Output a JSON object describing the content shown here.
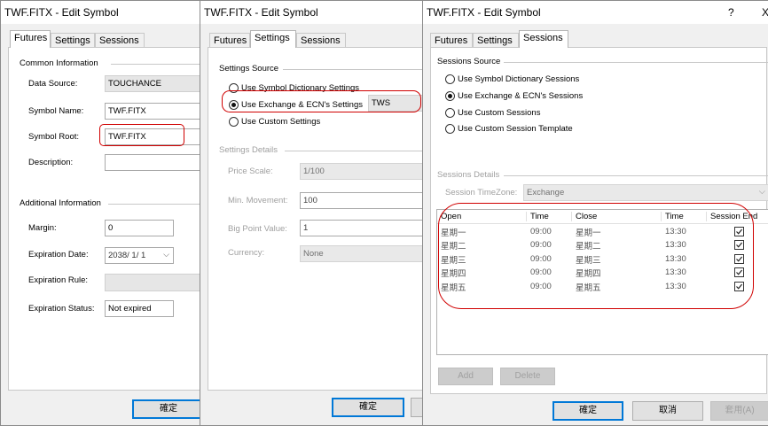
{
  "window1": {
    "title": "TWF.FITX - Edit Symbol",
    "tabs": [
      "Futures",
      "Settings",
      "Sessions"
    ],
    "common_header": "Common Information",
    "data_source_label": "Data Source:",
    "data_source_value": "TOUCHANCE",
    "symbol_name_label": "Symbol Name:",
    "symbol_name_value": "TWF.FITX",
    "symbol_root_label": "Symbol Root:",
    "symbol_root_value": "TWF.FITX",
    "description_label": "Description:",
    "description_value": "",
    "additional_header": "Additional Information",
    "margin_label": "Margin:",
    "margin_value": "0",
    "expiration_date_label": "Expiration Date:",
    "expiration_date_value": "2038/  1/  1",
    "expiration_rule_label": "Expiration Rule:",
    "expiration_status_label": "Expiration Status:",
    "expiration_status_value": "Not expired",
    "ok_label": "確定"
  },
  "window2": {
    "title": "TWF.FITX - Edit Symbol",
    "tabs": [
      "Futures",
      "Settings",
      "Sessions"
    ],
    "source_header": "Settings Source",
    "opt_dictionary": "Use Symbol Dictionary Settings",
    "opt_exchange": "Use Exchange & ECN's Settings",
    "exchange_value": "TWS",
    "opt_custom": "Use Custom Settings",
    "details_header": "Settings Details",
    "price_scale_label": "Price Scale:",
    "price_scale_value": "1/100",
    "min_movement_label": "Min. Movement:",
    "min_movement_value": "100",
    "big_point_label": "Big Point Value:",
    "big_point_value": "1",
    "currency_label": "Currency:",
    "currency_value": "None",
    "ok_label": "確定"
  },
  "window3": {
    "title": "TWF.FITX - Edit Symbol",
    "help_glyph": "?",
    "close_glyph": "X",
    "tabs": [
      "Futures",
      "Settings",
      "Sessions"
    ],
    "source_header": "Sessions Source",
    "opt_dictionary": "Use Symbol Dictionary Sessions",
    "opt_exchange": "Use Exchange & ECN's Sessions",
    "opt_custom": "Use Custom Sessions",
    "opt_template": "Use Custom Session Template",
    "details_header": "Sessions Details",
    "timezone_label": "Session TimeZone:",
    "timezone_value": "Exchange",
    "columns": [
      "Open",
      "Time",
      "Close",
      "Time",
      "Session End"
    ],
    "rows": [
      {
        "open": "星期一",
        "open_time": "09:00",
        "close": "星期一",
        "close_time": "13:30",
        "session_end": true
      },
      {
        "open": "星期二",
        "open_time": "09:00",
        "close": "星期二",
        "close_time": "13:30",
        "session_end": true
      },
      {
        "open": "星期三",
        "open_time": "09:00",
        "close": "星期三",
        "close_time": "13:30",
        "session_end": true
      },
      {
        "open": "星期四",
        "open_time": "09:00",
        "close": "星期四",
        "close_time": "13:30",
        "session_end": true
      },
      {
        "open": "星期五",
        "open_time": "09:00",
        "close": "星期五",
        "close_time": "13:30",
        "session_end": true
      }
    ],
    "add_label": "Add",
    "delete_label": "Delete",
    "ok_label": "確定",
    "cancel_label": "取消",
    "apply_label": "套用(A)"
  },
  "colors": {
    "highlight": "#d00000",
    "default_button_border": "#0078d7"
  }
}
